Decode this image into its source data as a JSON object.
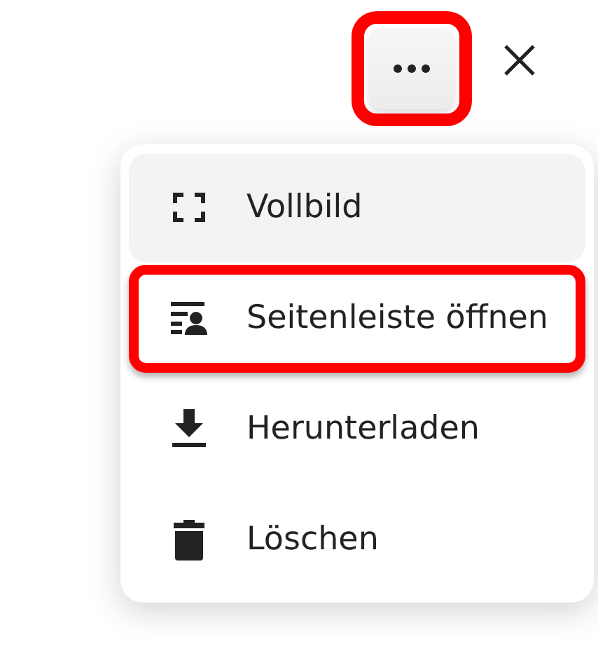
{
  "toolbar": {
    "more_button": {
      "highlighted": true
    },
    "close_button": {
      "highlighted": false
    }
  },
  "menu": {
    "items": [
      {
        "label": "Vollbild",
        "hovered": true,
        "highlighted": false
      },
      {
        "label": "Seitenleiste öffnen",
        "hovered": false,
        "highlighted": true
      },
      {
        "label": "Herunterladen",
        "hovered": false,
        "highlighted": false
      },
      {
        "label": "Löschen",
        "hovered": false,
        "highlighted": false
      }
    ]
  }
}
